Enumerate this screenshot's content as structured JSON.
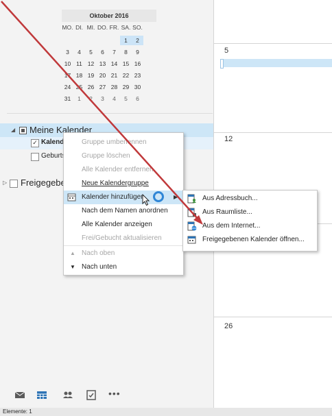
{
  "mini_calendar": {
    "month_label": "Oktober 2016",
    "weekdays": [
      "MO.",
      "DI.",
      "MI.",
      "DO.",
      "FR.",
      "SA.",
      "SO."
    ],
    "weeks": [
      [
        "",
        "",
        "",
        "",
        "",
        "1",
        "2"
      ],
      [
        "3",
        "4",
        "5",
        "6",
        "7",
        "8",
        "9"
      ],
      [
        "10",
        "11",
        "12",
        "13",
        "14",
        "15",
        "16"
      ],
      [
        "17",
        "18",
        "19",
        "20",
        "21",
        "22",
        "23"
      ],
      [
        "24",
        "25",
        "26",
        "27",
        "28",
        "29",
        "30"
      ],
      [
        "31",
        "1",
        "2",
        "3",
        "4",
        "5",
        "6"
      ]
    ]
  },
  "tree": {
    "my_calendars": "Meine Kalender",
    "calendar": "Kalender",
    "birthdays": "Geburtstage",
    "shared": "Freigegebene Kalender"
  },
  "calendar_view": {
    "dates": [
      "5",
      "12",
      "26"
    ]
  },
  "context_menu": {
    "items": [
      {
        "label": "Gruppe umbenennen"
      },
      {
        "label": "Gruppe löschen"
      },
      {
        "label": "Alle Kalender entfernen"
      },
      {
        "label": "Neue Kalendergruppe"
      },
      {
        "label": "Kalender hinzufügen"
      },
      {
        "label": "Nach dem Namen anordnen"
      },
      {
        "label": "Alle Kalender anzeigen"
      },
      {
        "label": "Frei/Gebucht aktualisieren"
      },
      {
        "label": "Nach oben"
      },
      {
        "label": "Nach unten"
      }
    ]
  },
  "submenu": {
    "items": [
      {
        "label": "Aus Adressbuch..."
      },
      {
        "label": "Aus Raumliste..."
      },
      {
        "label": "Aus dem Internet..."
      },
      {
        "label": "Freigegebenen Kalender öffnen..."
      }
    ]
  },
  "status": {
    "items_label": "Elemente: 1"
  },
  "colors": {
    "selection": "#cde6f7",
    "accent": "#2e74b5",
    "arrow": "#c0393b"
  }
}
